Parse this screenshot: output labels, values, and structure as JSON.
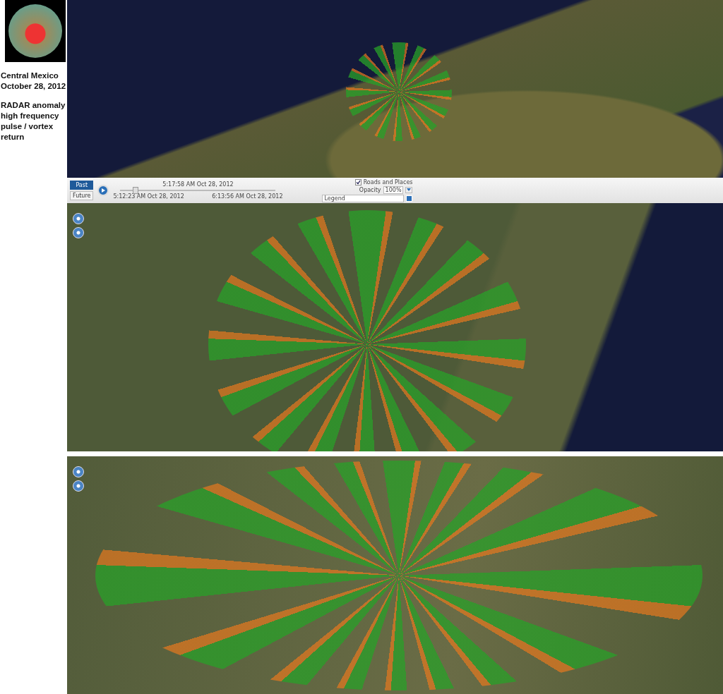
{
  "caption": {
    "title_lines": [
      "Central Mexico",
      "October 28, 2012"
    ],
    "note_lines": [
      "RADAR anomaly",
      "high frequency",
      "pulse / vortex",
      "return"
    ]
  },
  "toolbar": {
    "modes": [
      {
        "label": "Past",
        "selected": true
      },
      {
        "label": "Future",
        "selected": false
      }
    ],
    "current_time": "5:17:58 AM Oct 28, 2012",
    "slider": {
      "level": 0.08
    },
    "start_time": "5:12:23 AM Oct 28, 2012",
    "end_time": "6:13:56 AM Oct 28, 2012",
    "roads_and_places": {
      "label": "Roads and Places",
      "checked": true
    },
    "opacity": {
      "label": "Opacity",
      "value": "100%"
    },
    "legend": {
      "value": "Legend"
    }
  }
}
